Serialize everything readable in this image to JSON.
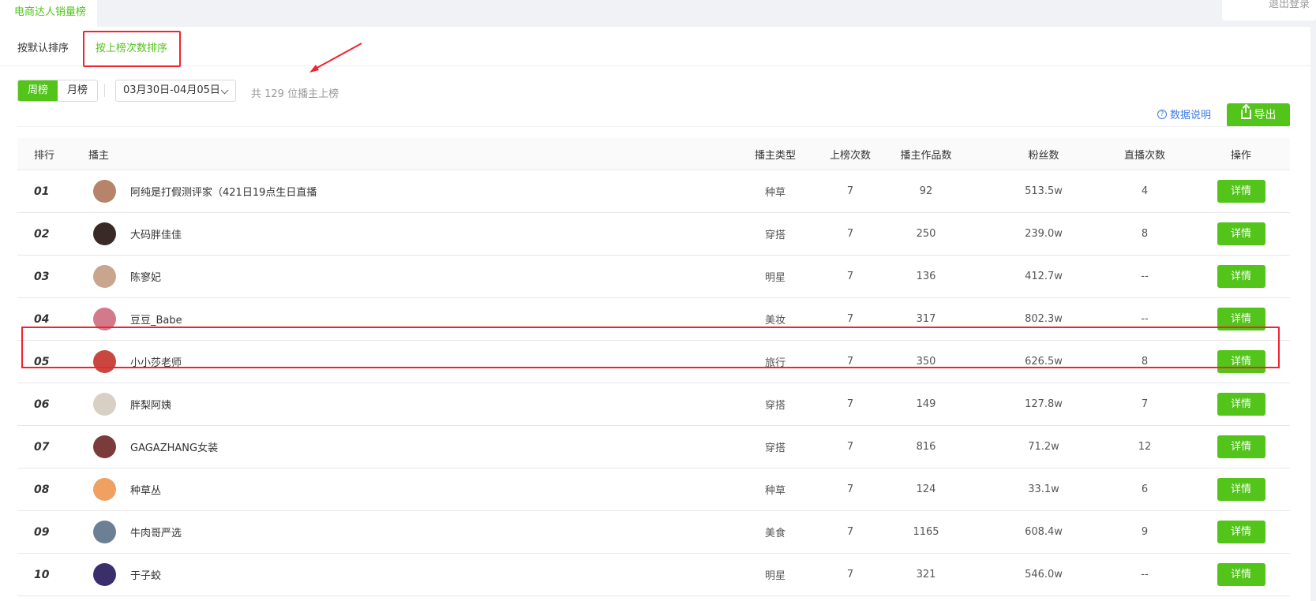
{
  "top": {
    "tab_label": "电商达人销量榜",
    "logout_label": "退出登录"
  },
  "sort_tabs": {
    "default_label": "按默认排序",
    "by_times_label": "按上榜次数排序"
  },
  "period": {
    "week_label": "周榜",
    "month_label": "月榜"
  },
  "date_range": "03月30日-04月05日",
  "total_text": "共 129 位播主上榜",
  "help_label": "数据说明",
  "help_icon_glyph": "?",
  "export_label": "导出",
  "columns": [
    "排行",
    "播主",
    "播主类型",
    "上榜次数",
    "播主作品数",
    "粉丝数",
    "直播次数",
    "操作"
  ],
  "detail_label": "详情",
  "rows": [
    {
      "rank": "01",
      "name": "阿纯是打假测评家（421日19点生日直播",
      "type": "种草",
      "times": "7",
      "works": "92",
      "fans": "513.5w",
      "live": "4",
      "avatar_color": "#b5846a"
    },
    {
      "rank": "02",
      "name": "大码胖佳佳",
      "type": "穿搭",
      "times": "7",
      "works": "250",
      "fans": "239.0w",
      "live": "8",
      "avatar_color": "#3a2a26"
    },
    {
      "rank": "03",
      "name": "陈寥妃",
      "type": "明星",
      "times": "7",
      "works": "136",
      "fans": "412.7w",
      "live": "--",
      "avatar_color": "#c9a48f"
    },
    {
      "rank": "04",
      "name": "豆豆_Babe",
      "type": "美妆",
      "times": "7",
      "works": "317",
      "fans": "802.3w",
      "live": "--",
      "avatar_color": "#d37a8a"
    },
    {
      "rank": "05",
      "name": "小小莎老师",
      "type": "旅行",
      "times": "7",
      "works": "350",
      "fans": "626.5w",
      "live": "8",
      "avatar_color": "#c9473f"
    },
    {
      "rank": "06",
      "name": "胖梨阿姨",
      "type": "穿搭",
      "times": "7",
      "works": "149",
      "fans": "127.8w",
      "live": "7",
      "avatar_color": "#d8d0c4"
    },
    {
      "rank": "07",
      "name": "GAGAZHANG女装",
      "type": "穿搭",
      "times": "7",
      "works": "816",
      "fans": "71.2w",
      "live": "12",
      "avatar_color": "#7a3b3a"
    },
    {
      "rank": "08",
      "name": "种草丛",
      "type": "种草",
      "times": "7",
      "works": "124",
      "fans": "33.1w",
      "live": "6",
      "avatar_color": "#f0a060"
    },
    {
      "rank": "09",
      "name": "牛肉哥严选",
      "type": "美食",
      "times": "7",
      "works": "1165",
      "fans": "608.4w",
      "live": "9",
      "avatar_color": "#6d7f95"
    },
    {
      "rank": "10",
      "name": "于子蛟",
      "type": "明星",
      "times": "7",
      "works": "321",
      "fans": "546.0w",
      "live": "--",
      "avatar_color": "#3b2f6b"
    }
  ],
  "colors": {
    "accent": "#52c41a",
    "highlight": "#f5222d",
    "link": "#3d7ce6"
  }
}
